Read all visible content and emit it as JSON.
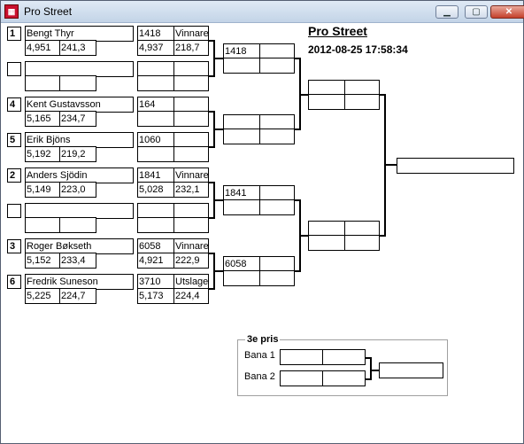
{
  "window": {
    "title": "Pro Street",
    "icon": "app-flag-icon"
  },
  "caption": {
    "minimize": "▁",
    "maximize": "▢",
    "close": "✕"
  },
  "header": {
    "title": "Pro Street",
    "datetime": "2012-08-25 17:58:34"
  },
  "round1": [
    {
      "seed": "1",
      "name": "Bengt Thyr",
      "sub1": "4,951",
      "sub2": "241,3",
      "res1": "1418",
      "res2": "Vinnare",
      "res3": "4,937",
      "res4": "218,7"
    },
    {
      "seed": "",
      "name": "",
      "sub1": "",
      "sub2": "",
      "res1": "",
      "res2": "",
      "res3": "",
      "res4": ""
    },
    {
      "seed": "4",
      "name": "Kent Gustavsson",
      "sub1": "5,165",
      "sub2": "234,7",
      "res1": "164",
      "res2": "",
      "res3": "",
      "res4": ""
    },
    {
      "seed": "5",
      "name": "Erik Bjöns",
      "sub1": "5,192",
      "sub2": "219,2",
      "res1": "1060",
      "res2": "",
      "res3": "",
      "res4": ""
    },
    {
      "seed": "2",
      "name": "Anders Sjödin",
      "sub1": "5,149",
      "sub2": "223,0",
      "res1": "1841",
      "res2": "Vinnare",
      "res3": "5,028",
      "res4": "232,1"
    },
    {
      "seed": "",
      "name": "",
      "sub1": "",
      "sub2": "",
      "res1": "",
      "res2": "",
      "res3": "",
      "res4": ""
    },
    {
      "seed": "3",
      "name": "Roger Bøkseth",
      "sub1": "5,152",
      "sub2": "233,4",
      "res1": "6058",
      "res2": "Vinnare",
      "res3": "4,921",
      "res4": "222,9"
    },
    {
      "seed": "6",
      "name": "Fredrik Suneson",
      "sub1": "5,225",
      "sub2": "224,7",
      "res1": "3710",
      "res2": "Utslagen",
      "res3": "5,173",
      "res4": "224,4"
    }
  ],
  "round2": [
    {
      "a": "1418",
      "b": "",
      "c": "",
      "d": ""
    },
    {
      "a": "",
      "b": "",
      "c": "",
      "d": ""
    },
    {
      "a": "1841",
      "b": "",
      "c": "",
      "d": ""
    },
    {
      "a": "6058",
      "b": "",
      "c": "",
      "d": ""
    }
  ],
  "round3": [
    {
      "a": "",
      "b": "",
      "c": "",
      "d": ""
    },
    {
      "a": "",
      "b": "",
      "c": "",
      "d": ""
    }
  ],
  "final": {
    "winner": ""
  },
  "third_place": {
    "title": "3e pris",
    "lane1_label": "Bana 1",
    "lane2_label": "Bana 2",
    "lane1": {
      "a": "",
      "b": ""
    },
    "lane2": {
      "a": "",
      "b": ""
    },
    "winner": ""
  }
}
